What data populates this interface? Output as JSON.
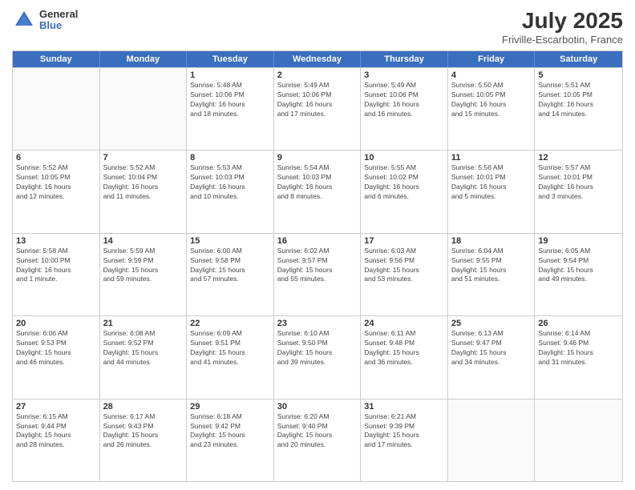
{
  "header": {
    "logo": {
      "general": "General",
      "blue": "Blue"
    },
    "title": "July 2025",
    "location": "Friville-Escarbotin, France"
  },
  "days": [
    "Sunday",
    "Monday",
    "Tuesday",
    "Wednesday",
    "Thursday",
    "Friday",
    "Saturday"
  ],
  "weeks": [
    [
      {
        "date": "",
        "info": ""
      },
      {
        "date": "",
        "info": ""
      },
      {
        "date": "1",
        "info": "Sunrise: 5:48 AM\nSunset: 10:06 PM\nDaylight: 16 hours\nand 18 minutes."
      },
      {
        "date": "2",
        "info": "Sunrise: 5:49 AM\nSunset: 10:06 PM\nDaylight: 16 hours\nand 17 minutes."
      },
      {
        "date": "3",
        "info": "Sunrise: 5:49 AM\nSunset: 10:06 PM\nDaylight: 16 hours\nand 16 minutes."
      },
      {
        "date": "4",
        "info": "Sunrise: 5:50 AM\nSunset: 10:05 PM\nDaylight: 16 hours\nand 15 minutes."
      },
      {
        "date": "5",
        "info": "Sunrise: 5:51 AM\nSunset: 10:05 PM\nDaylight: 16 hours\nand 14 minutes."
      }
    ],
    [
      {
        "date": "6",
        "info": "Sunrise: 5:52 AM\nSunset: 10:05 PM\nDaylight: 16 hours\nand 12 minutes."
      },
      {
        "date": "7",
        "info": "Sunrise: 5:52 AM\nSunset: 10:04 PM\nDaylight: 16 hours\nand 11 minutes."
      },
      {
        "date": "8",
        "info": "Sunrise: 5:53 AM\nSunset: 10:03 PM\nDaylight: 16 hours\nand 10 minutes."
      },
      {
        "date": "9",
        "info": "Sunrise: 5:54 AM\nSunset: 10:03 PM\nDaylight: 16 hours\nand 8 minutes."
      },
      {
        "date": "10",
        "info": "Sunrise: 5:55 AM\nSunset: 10:02 PM\nDaylight: 16 hours\nand 6 minutes."
      },
      {
        "date": "11",
        "info": "Sunrise: 5:56 AM\nSunset: 10:01 PM\nDaylight: 16 hours\nand 5 minutes."
      },
      {
        "date": "12",
        "info": "Sunrise: 5:57 AM\nSunset: 10:01 PM\nDaylight: 16 hours\nand 3 minutes."
      }
    ],
    [
      {
        "date": "13",
        "info": "Sunrise: 5:58 AM\nSunset: 10:00 PM\nDaylight: 16 hours\nand 1 minute."
      },
      {
        "date": "14",
        "info": "Sunrise: 5:59 AM\nSunset: 9:59 PM\nDaylight: 15 hours\nand 59 minutes."
      },
      {
        "date": "15",
        "info": "Sunrise: 6:00 AM\nSunset: 9:58 PM\nDaylight: 15 hours\nand 57 minutes."
      },
      {
        "date": "16",
        "info": "Sunrise: 6:02 AM\nSunset: 9:57 PM\nDaylight: 15 hours\nand 55 minutes."
      },
      {
        "date": "17",
        "info": "Sunrise: 6:03 AM\nSunset: 9:56 PM\nDaylight: 15 hours\nand 53 minutes."
      },
      {
        "date": "18",
        "info": "Sunrise: 6:04 AM\nSunset: 9:55 PM\nDaylight: 15 hours\nand 51 minutes."
      },
      {
        "date": "19",
        "info": "Sunrise: 6:05 AM\nSunset: 9:54 PM\nDaylight: 15 hours\nand 49 minutes."
      }
    ],
    [
      {
        "date": "20",
        "info": "Sunrise: 6:06 AM\nSunset: 9:53 PM\nDaylight: 15 hours\nand 46 minutes."
      },
      {
        "date": "21",
        "info": "Sunrise: 6:08 AM\nSunset: 9:52 PM\nDaylight: 15 hours\nand 44 minutes."
      },
      {
        "date": "22",
        "info": "Sunrise: 6:09 AM\nSunset: 9:51 PM\nDaylight: 15 hours\nand 41 minutes."
      },
      {
        "date": "23",
        "info": "Sunrise: 6:10 AM\nSunset: 9:50 PM\nDaylight: 15 hours\nand 39 minutes."
      },
      {
        "date": "24",
        "info": "Sunrise: 6:11 AM\nSunset: 9:48 PM\nDaylight: 15 hours\nand 36 minutes."
      },
      {
        "date": "25",
        "info": "Sunrise: 6:13 AM\nSunset: 9:47 PM\nDaylight: 15 hours\nand 34 minutes."
      },
      {
        "date": "26",
        "info": "Sunrise: 6:14 AM\nSunset: 9:46 PM\nDaylight: 15 hours\nand 31 minutes."
      }
    ],
    [
      {
        "date": "27",
        "info": "Sunrise: 6:15 AM\nSunset: 9:44 PM\nDaylight: 15 hours\nand 28 minutes."
      },
      {
        "date": "28",
        "info": "Sunrise: 6:17 AM\nSunset: 9:43 PM\nDaylight: 15 hours\nand 26 minutes."
      },
      {
        "date": "29",
        "info": "Sunrise: 6:18 AM\nSunset: 9:42 PM\nDaylight: 15 hours\nand 23 minutes."
      },
      {
        "date": "30",
        "info": "Sunrise: 6:20 AM\nSunset: 9:40 PM\nDaylight: 15 hours\nand 20 minutes."
      },
      {
        "date": "31",
        "info": "Sunrise: 6:21 AM\nSunset: 9:39 PM\nDaylight: 15 hours\nand 17 minutes."
      },
      {
        "date": "",
        "info": ""
      },
      {
        "date": "",
        "info": ""
      }
    ]
  ]
}
